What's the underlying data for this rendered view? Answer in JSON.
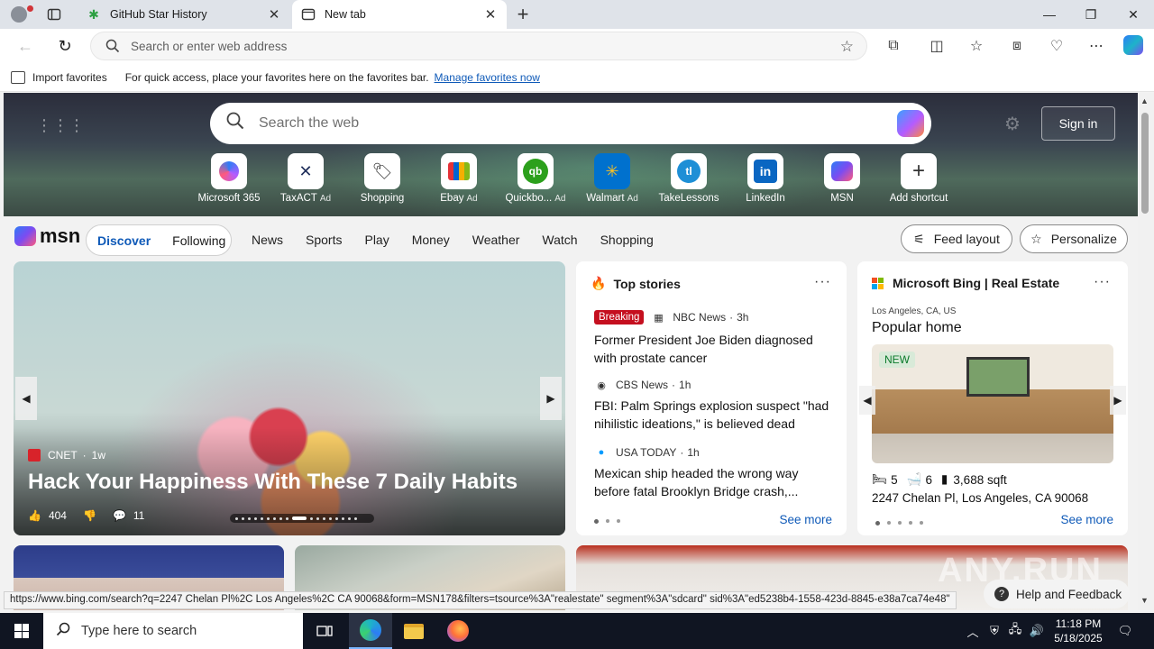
{
  "browser": {
    "tabs": [
      {
        "title": "GitHub Star History",
        "icon": "github-star-icon"
      },
      {
        "title": "New tab",
        "icon": "newtab-icon"
      }
    ],
    "address_placeholder": "Search or enter web address"
  },
  "favorites_bar": {
    "import_label": "Import favorites",
    "message": "For quick access, place your favorites here on the favorites bar.",
    "manage_link": "Manage favorites now"
  },
  "newtab": {
    "search_placeholder": "Search the web",
    "sign_in": "Sign in",
    "shortcuts": [
      {
        "label": "Microsoft 365",
        "ad": ""
      },
      {
        "label": "TaxACT",
        "ad": "Ad"
      },
      {
        "label": "Shopping",
        "ad": ""
      },
      {
        "label": "Ebay",
        "ad": "Ad"
      },
      {
        "label": "Quickbo...",
        "ad": "Ad"
      },
      {
        "label": "Walmart",
        "ad": "Ad"
      },
      {
        "label": "TakeLessons",
        "ad": ""
      },
      {
        "label": "LinkedIn",
        "ad": ""
      },
      {
        "label": "MSN",
        "ad": ""
      },
      {
        "label": "Add shortcut",
        "ad": ""
      }
    ]
  },
  "msn": {
    "logo": "msn",
    "pill": [
      "Discover",
      "Following"
    ],
    "nav": [
      "News",
      "Sports",
      "Play",
      "Money",
      "Weather",
      "Watch",
      "Shopping"
    ],
    "feed_layout": "Feed layout",
    "personalize": "Personalize"
  },
  "hero_story": {
    "source": "CNET",
    "age": "1w",
    "headline": "Hack Your Happiness With These 7 Daily Habits",
    "likes": "404",
    "comments": "11"
  },
  "top_stories": {
    "title": "Top stories",
    "items": [
      {
        "badge": "Breaking",
        "source": "NBC News",
        "age": "3h",
        "title": "Former President Joe Biden diagnosed with prostate cancer"
      },
      {
        "badge": "",
        "source": "CBS News",
        "age": "1h",
        "title": "FBI: Palm Springs explosion suspect \"had nihilistic ideations,\" is believed dead"
      },
      {
        "badge": "",
        "source": "USA TODAY",
        "age": "1h",
        "title": "Mexican ship headed the wrong way before fatal Brooklyn Bridge crash,..."
      }
    ],
    "see_more": "See more"
  },
  "real_estate": {
    "title": "Microsoft Bing | Real Estate",
    "location": "Los Angeles, CA, US",
    "heading": "Popular home",
    "badge": "NEW",
    "beds": "5",
    "baths": "6",
    "sqft": "3,688 sqft",
    "address": "2247 Chelan Pl, Los Angeles, CA 90068",
    "see_more": "See more"
  },
  "status_url": "https://www.bing.com/search?q=2247 Chelan Pl%2C Los Angeles%2C CA 90068&form=MSN178&filters=tsource%3A\"realestate\" segment%3A\"sdcard\" sid%3A\"ed5238b4-1558-423d-8845-e38a7ca74e48\"",
  "help_feedback": "Help and Feedback",
  "taskbar": {
    "search_placeholder": "Type here to search",
    "time": "11:18 PM",
    "date": "5/18/2025"
  },
  "watermark": "ANY.RUN",
  "colors": {
    "accent": "#0f5ab8",
    "breaking": "#c50f1f",
    "taskbar": "#101522"
  }
}
